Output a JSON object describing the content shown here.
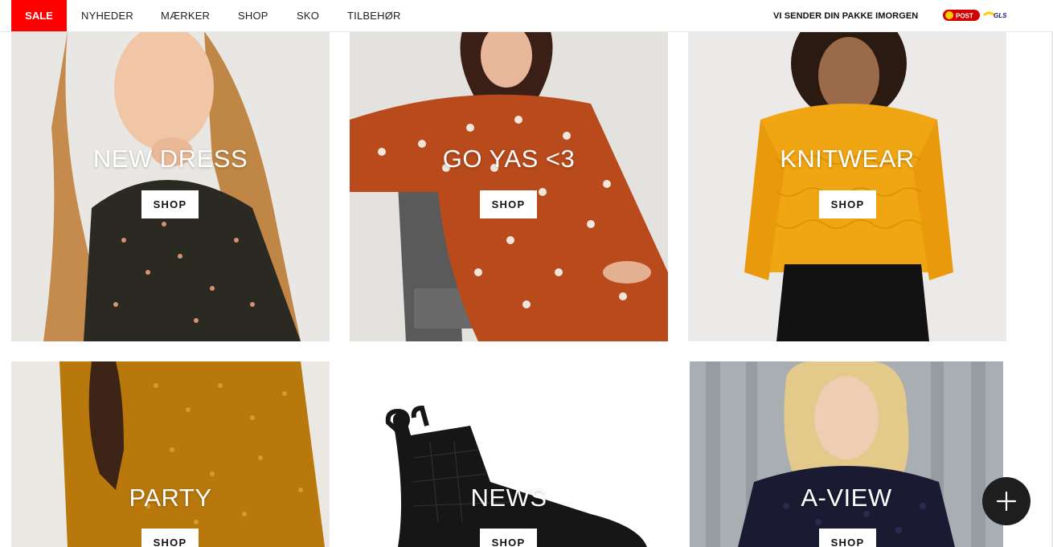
{
  "nav": {
    "sale_label": "SALE",
    "items": [
      "NYHEDER",
      "MÆRKER",
      "SHOP",
      "SKO",
      "TILBEHØR"
    ],
    "shipping_note": "VI SENDER DIN PAKKE IMORGEN",
    "carrier_logos": [
      "POST",
      "GLS"
    ],
    "sale_color": "#ff0000"
  },
  "tiles": [
    {
      "title": "NEW DRESS",
      "button": "SHOP"
    },
    {
      "title": "GO YAS <3",
      "button": "SHOP"
    },
    {
      "title": "KNITWEAR",
      "button": "SHOP"
    },
    {
      "title": "PARTY",
      "button": "SHOP"
    },
    {
      "title": "NEWS",
      "button": "SHOP"
    },
    {
      "title": "A-VIEW",
      "button": "SHOP"
    }
  ],
  "fab": {
    "icon": "plus-icon"
  }
}
